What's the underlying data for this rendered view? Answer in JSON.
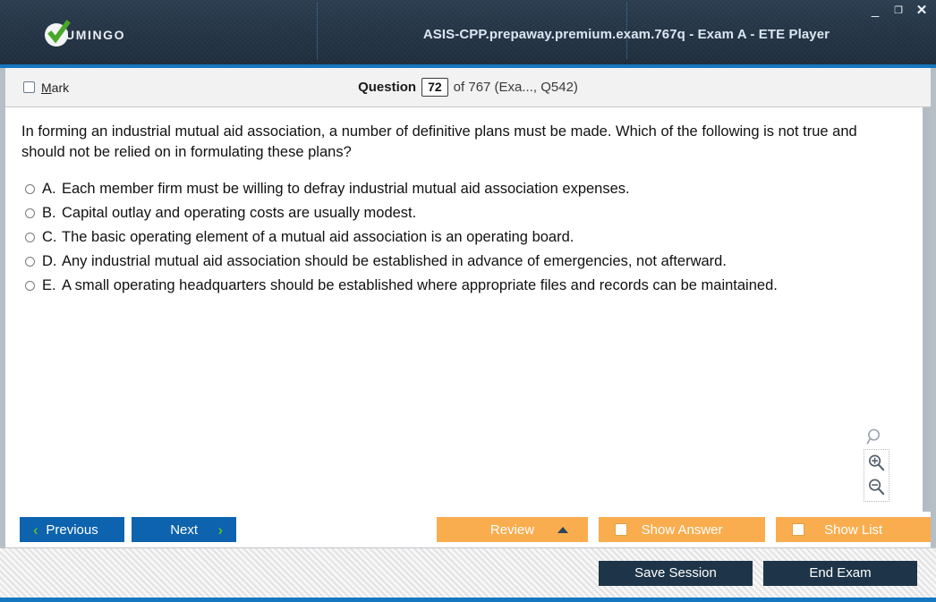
{
  "window": {
    "title": "ASIS-CPP.prepaway.premium.exam.767q - Exam A - ETE Player",
    "logo_text": "UMINGO",
    "controls": {
      "minimize": "_",
      "maximize": "❐",
      "close": "✕"
    },
    "accent_blue": "#1477bf",
    "titlebar_color": "#253546"
  },
  "question_header": {
    "mark_label_prefix": "",
    "mark_label": "Mark",
    "counter_label": "Question",
    "current_number": "72",
    "counter_rest": "of 767 (Exa..., Q542)"
  },
  "question": {
    "text": "In forming an industrial mutual aid association, a number of definitive plans must be made. Which of the following is not true and should not be relied on in formulating these plans?",
    "options": [
      {
        "letter": "A.",
        "text": "Each member firm must be willing to defray industrial mutual aid association expenses."
      },
      {
        "letter": "B.",
        "text": "Capital outlay and operating costs are usually modest."
      },
      {
        "letter": "C.",
        "text": "The basic operating element of a mutual aid association is an operating board."
      },
      {
        "letter": "D.",
        "text": "Any industrial mutual aid association should be established in advance of emergencies, not afterward."
      },
      {
        "letter": "E.",
        "text": "A small operating headquarters should be established where appropriate files and records can be maintained."
      }
    ]
  },
  "zoom_tools": {
    "search_icon_name": "magnifier",
    "zoom_in_icon_name": "magnifier-plus",
    "zoom_out_icon_name": "magnifier-minus"
  },
  "actions": {
    "previous": "Previous",
    "next": "Next",
    "review": "Review",
    "show_answer": "Show Answer",
    "show_list": "Show List",
    "chevron_left": "‹",
    "chevron_right": "›",
    "accent_orange": "#f9ad4e",
    "accent_button_blue": "#0d63ae",
    "chevron_green": "#5eb832"
  },
  "status": {
    "save_session": "Save Session",
    "end_exam": "End Exam",
    "dark_button_color": "#1e3549"
  }
}
